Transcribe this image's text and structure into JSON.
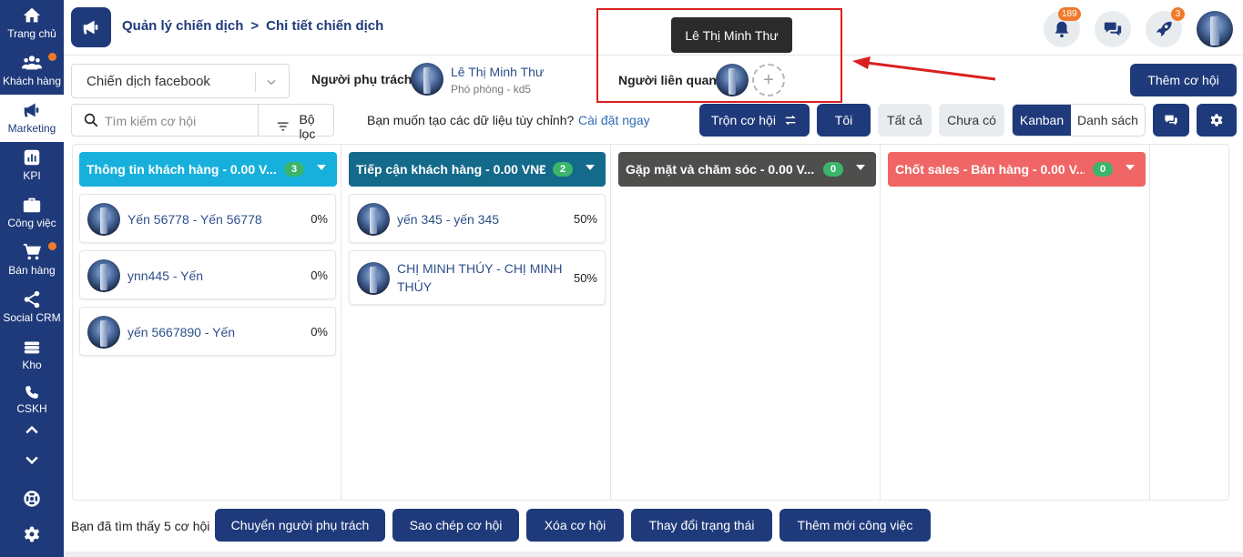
{
  "sidebar": {
    "items": [
      {
        "label": "Trang chủ",
        "icon": "home-icon"
      },
      {
        "label": "Khách hàng",
        "icon": "users-icon"
      },
      {
        "label": "Marketing",
        "icon": "megaphone-icon"
      },
      {
        "label": "KPI",
        "icon": "chart-icon"
      },
      {
        "label": "Công việc",
        "icon": "briefcase-icon"
      },
      {
        "label": "Bán hàng",
        "icon": "cart-icon"
      },
      {
        "label": "Social CRM",
        "icon": "share-icon"
      },
      {
        "label": "Kho",
        "icon": "warehouse-icon"
      },
      {
        "label": "CSKH",
        "icon": "phone-icon"
      }
    ]
  },
  "header": {
    "breadcrumb_parent": "Quản lý chiến dịch",
    "breadcrumb_sep": ">",
    "breadcrumb_current": "Chi tiết chiến dịch",
    "notif_count": "189",
    "rocket_count": "3"
  },
  "tooltip": {
    "text": "Lê Thị Minh Thư"
  },
  "campaign": {
    "selected": "Chiến dịch facebook",
    "owner_label": "Người phụ trách",
    "owner_name": "Lê Thị Minh Thư",
    "owner_role": "Phó phòng - kd5",
    "related_label": "Người liên quan",
    "add_symbol": "+"
  },
  "toolbar": {
    "add_opportunity": "Thêm cơ hội",
    "search_placeholder": "Tìm kiếm cơ hội",
    "filter_label": "Bộ lọc",
    "custom_prompt": "Bạn muốn tạo các dữ liệu tùy chỉnh?",
    "custom_link": "Cài đặt ngay",
    "merge": "Trộn cơ hội",
    "mine": "Tôi",
    "all": "Tất cả",
    "none": "Chưa có",
    "kanban": "Kanban",
    "list": "Danh sách"
  },
  "columns": [
    {
      "title": "Thông tin khách hàng - 0.00 V...",
      "count": "3",
      "color": "#17b0dc",
      "cards": [
        {
          "name": "Yến 56778 - Yến 56778",
          "pct": "0%"
        },
        {
          "name": "ynn445 - Yến",
          "pct": "0%"
        },
        {
          "name": "yến 5667890 - Yến",
          "pct": "0%"
        }
      ]
    },
    {
      "title": "Tiếp cận khách hàng - 0.00 VNĐ",
      "count": "2",
      "color": "#146a8a",
      "cards": [
        {
          "name": "yến 345 - yến 345",
          "pct": "50%"
        },
        {
          "name_line1": "CHỊ MINH THÚY - CHỊ MINH",
          "name_line2": "THÚY",
          "pct": "50%"
        }
      ]
    },
    {
      "title": "Gặp mặt và chăm sóc - 0.00 V...",
      "count": "0",
      "color": "#4e4e4c",
      "cards": []
    },
    {
      "title": "Chốt sales - Bán hàng - 0.00 V...",
      "count": "0",
      "color": "#f06666",
      "cards": []
    }
  ],
  "footer": {
    "found": "Bạn đã tìm thấy 5 cơ hội",
    "actions": [
      "Chuyển người phụ trách",
      "Sao chép cơ hội",
      "Xóa cơ hội",
      "Thay đổi trạng thái",
      "Thêm mới công việc"
    ]
  },
  "colors": {
    "primary": "#1f3a7a",
    "accent": "#f07a2c",
    "highlight": "#d9201f"
  }
}
